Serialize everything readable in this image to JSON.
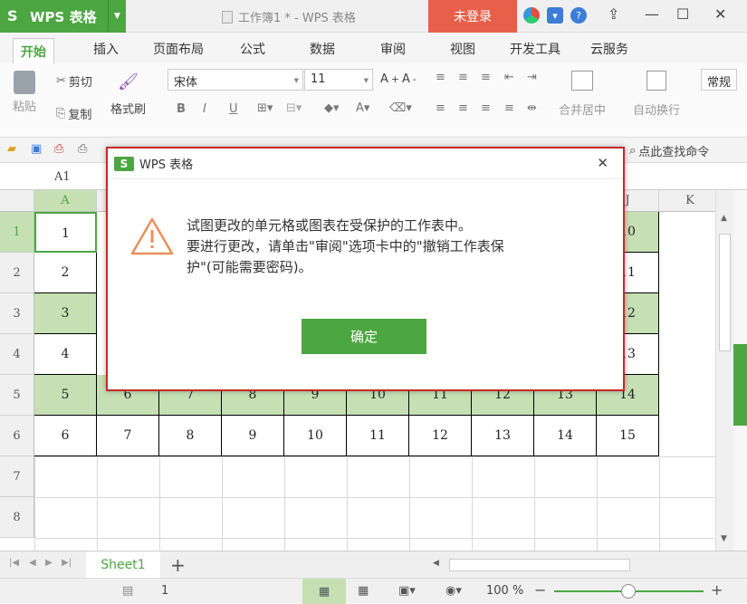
{
  "window": {
    "app_name": "WPS 表格",
    "doc_title": "工作簿1 * - WPS 表格",
    "login_label": "未登录"
  },
  "tabs": [
    "开始",
    "插入",
    "页面布局",
    "公式",
    "数据",
    "审阅",
    "视图",
    "开发工具",
    "云服务"
  ],
  "ribbon": {
    "paste": "粘贴",
    "cut": "剪切",
    "copy": "复制",
    "format_painter": "格式刷",
    "font_name": "宋体",
    "font_size": "11",
    "merge_center": "合并居中",
    "wrap_text": "自动换行",
    "number_format": "常规"
  },
  "quick_access": {
    "search_command": "点此查找命令"
  },
  "formula_bar": {
    "name_box": "A1"
  },
  "grid": {
    "columns": [
      "A",
      "J",
      "K"
    ],
    "row_numbers": [
      "1",
      "2",
      "3",
      "4",
      "5",
      "6",
      "7",
      "8"
    ],
    "col_a_values": [
      "1",
      "2",
      "3",
      "4",
      "5",
      "6"
    ],
    "col_j_values": [
      "10",
      "11",
      "12",
      "13",
      "14",
      "15"
    ],
    "row5_values": [
      "5",
      "6",
      "7",
      "8",
      "9",
      "10",
      "11",
      "12",
      "13",
      "14"
    ],
    "row6_values": [
      "6",
      "7",
      "8",
      "9",
      "10",
      "11",
      "12",
      "13",
      "14",
      "15"
    ]
  },
  "sheet_tabs": {
    "active_sheet": "Sheet1"
  },
  "status_bar": {
    "page_num": "1",
    "zoom": "100 %"
  },
  "dialog": {
    "title": "WPS 表格",
    "message_line1": "试图更改的单元格或图表在受保护的工作表中。",
    "message_line2": "要进行更改，请单击\"审阅\"选项卡中的\"撤销工作表保",
    "message_line3": "护\"(可能需要密码)。",
    "ok_label": "确定"
  },
  "colors": {
    "accent_green": "#4ca641",
    "login_red": "#e8604a",
    "dialog_border": "#c62828",
    "highlight_row": "#c6e0b4"
  }
}
